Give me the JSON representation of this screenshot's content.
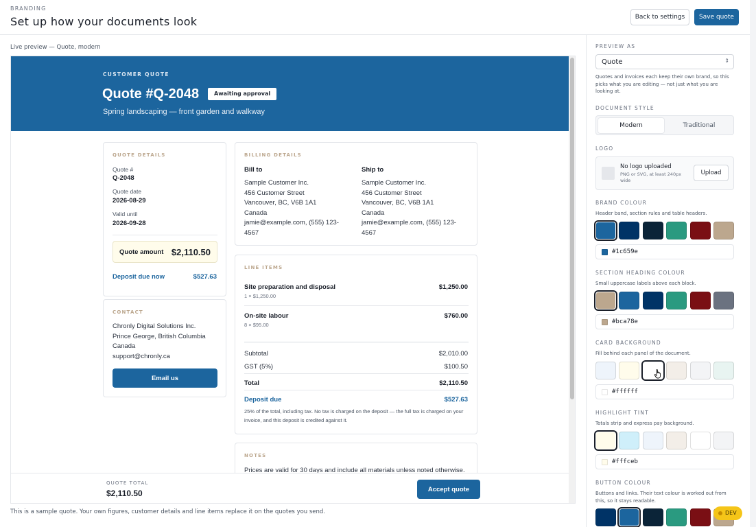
{
  "header": {
    "crumb": "BRANDING",
    "title": "Set up how your documents look",
    "back_label": "Back to settings",
    "save_label": "Save quote"
  },
  "preview": {
    "label": "Live preview — Quote, modern",
    "sample_note": "This is a sample quote. Your own figures, customer details and line items replace it on the quotes you send."
  },
  "doc": {
    "kicker": "CUSTOMER QUOTE",
    "title": "Quote #Q-2048",
    "badge": "Awaiting approval",
    "subtitle": "Spring landscaping — front garden and walkway",
    "quote_details": {
      "heading": "QUOTE DETAILS",
      "number_label": "Quote #",
      "number": "Q-2048",
      "date_label": "Quote date",
      "date": "2026-08-29",
      "valid_label": "Valid until",
      "valid": "2026-09-28",
      "amount_label": "Quote amount",
      "amount": "$2,110.50",
      "deposit_label": "Deposit due now",
      "deposit": "$527.63"
    },
    "contact": {
      "heading": "CONTACT",
      "lines": [
        "Chronly Digital Solutions Inc.",
        "Prince George, British Columbia",
        "Canada",
        "support@chronly.ca"
      ],
      "button": "Email us"
    },
    "billing": {
      "heading": "BILLING DETAILS",
      "bill_to_label": "Bill to",
      "bill_to": [
        "Sample Customer Inc.",
        "456 Customer Street",
        "Vancouver, BC, V6B 1A1",
        "Canada",
        "jamie@example.com, (555) 123-",
        "4567"
      ],
      "ship_to_label": "Ship to",
      "ship_to": [
        "Sample Customer Inc.",
        "456 Customer Street",
        "Vancouver, BC, V6B 1A1",
        "Canada",
        "jamie@example.com, (555) 123-",
        "4567"
      ]
    },
    "line_items": {
      "heading": "LINE ITEMS",
      "items": [
        {
          "name": "Site preparation and disposal",
          "detail": "1 × $1,250.00",
          "amount": "$1,250.00"
        },
        {
          "name": "On-site labour",
          "detail": "8 × $95.00",
          "amount": "$760.00"
        }
      ],
      "subtotal_label": "Subtotal",
      "subtotal": "$2,010.00",
      "tax_label": "GST (5%)",
      "tax": "$100.50",
      "total_label": "Total",
      "total": "$2,110.50",
      "deposit_label": "Deposit due",
      "deposit": "$527.63",
      "fine_print": "25% of the total, including tax. No tax is charged on the deposit — the full tax is charged on your invoice, and this deposit is credited against it."
    },
    "notes": {
      "heading": "NOTES",
      "text": "Prices are valid for 30 days and include all materials unless noted otherwise."
    },
    "footer": {
      "kicker": "QUOTE TOTAL",
      "total": "$2,110.50",
      "accept": "Accept quote"
    }
  },
  "panel": {
    "preview_as": {
      "heading": "PREVIEW AS",
      "value": "Quote",
      "help": "Quotes and invoices each keep their own brand, so this picks what you are editing — not just what you are looking at."
    },
    "document_style": {
      "heading": "DOCUMENT STYLE",
      "options": [
        "Modern",
        "Traditional"
      ],
      "selected": "Modern"
    },
    "logo": {
      "heading": "LOGO",
      "title": "No logo uploaded",
      "help": "PNG or SVG, at least 240px wide",
      "button": "Upload"
    },
    "brand_colour": {
      "heading": "BRAND COLOUR",
      "help": "Header band, section rules and table headers.",
      "swatches": [
        "#1c659e",
        "#003366",
        "#0b2438",
        "#2a9a80",
        "#7a0f14",
        "#bca78e"
      ],
      "value": "#1c659e"
    },
    "section_heading_colour": {
      "heading": "SECTION HEADING COLOUR",
      "help": "Small uppercase labels above each block.",
      "swatches": [
        "#bca78e",
        "#1c659e",
        "#003366",
        "#2a9a80",
        "#7a0f14",
        "#6b7280"
      ],
      "value": "#bca78e"
    },
    "card_background": {
      "heading": "CARD BACKGROUND",
      "help": "Fill behind each panel of the document.",
      "swatches": [
        "#eef4fb",
        "#fffceb",
        "#ffffff",
        "#f3eee8",
        "#f3f4f6",
        "#e8f4f1"
      ],
      "value": "#ffffff"
    },
    "highlight_tint": {
      "heading": "HIGHLIGHT TINT",
      "help": "Totals strip and express pay background.",
      "swatches": [
        "#fffceb",
        "#cfeffa",
        "#eef4fb",
        "#f3eee8",
        "#ffffff",
        "#f3f4f6"
      ],
      "value": "#fffceb"
    },
    "button_colour": {
      "heading": "BUTTON COLOUR",
      "help": "Buttons and links. Their text colour is worked out from this, so it stays readable.",
      "swatches": [
        "#003366",
        "#1c659e",
        "#0b2438",
        "#2a9a80",
        "#7a0f14",
        "#bca78e"
      ]
    }
  },
  "dev_badge": "DEV"
}
